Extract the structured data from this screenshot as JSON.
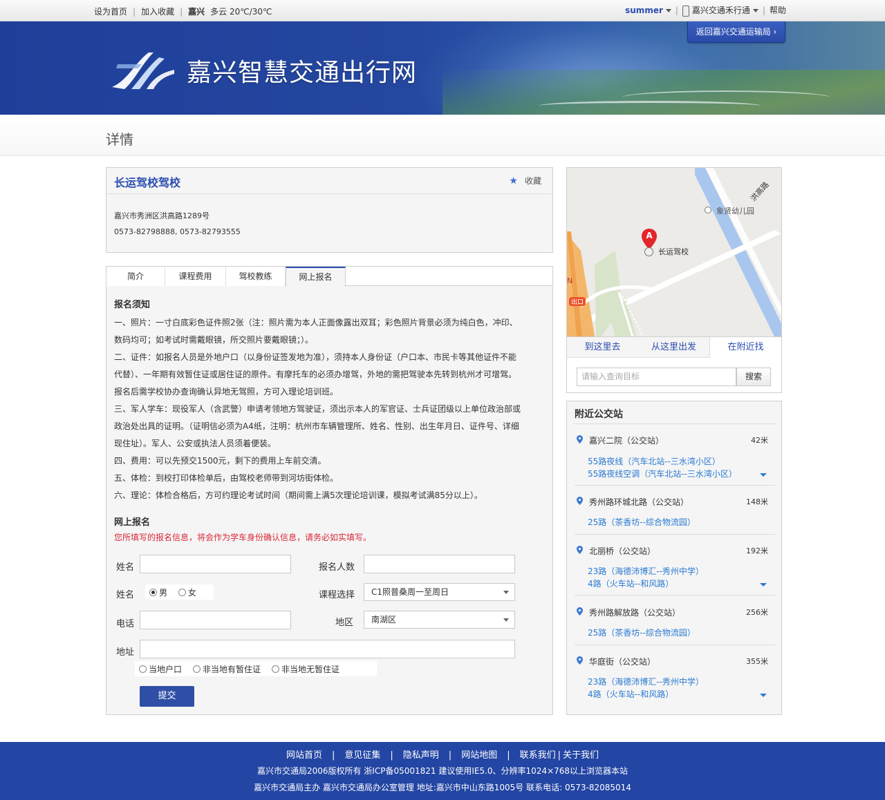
{
  "topbar": {
    "set_home": "设为首页",
    "add_fav": "加入收藏",
    "city": "嘉兴",
    "weather": "多云 20℃/30℃",
    "user": "summer",
    "app": "嘉兴交通禾行通",
    "help": "帮助"
  },
  "banner": {
    "site_title": "嘉兴智慧交通出行网",
    "back_label": "返回嘉兴交通运输局 ›"
  },
  "page": {
    "title": "详情"
  },
  "school": {
    "name": "长运驾校驾校",
    "fav_label": "收藏",
    "address": "嘉兴市秀洲区洪高路1289号",
    "phone": "0573-82798888, 0573-82793555"
  },
  "tabs": [
    {
      "label": "简介"
    },
    {
      "label": "课程费用"
    },
    {
      "label": "驾校教练"
    },
    {
      "label": "网上报名"
    }
  ],
  "notice": {
    "title": "报名须知",
    "lines": [
      "一、照片：一寸白底彩色证件照2张（注：照片需为本人正面像露出双耳；彩色照片背景必须为纯白色，冲印、",
      "数码均可；如考试时需戴眼镜，所交照片要戴眼镜；）。",
      "二、证件：如报名人员是外地户口（以身份证签发地为准），须持本人身份证（户口本、市民卡等其他证件不能",
      "代替）、一年期有效暂住证或居住证的原件。有摩托车的必须办增驾，外地的需把驾驶本先转到杭州才可增驾。",
      "报名后需学校协办查询确认异地无驾照，方可入理论培训班。",
      "三、军人学车：现役军人（含武警）申请考领地方驾驶证，须出示本人的军官证、士兵证团级以上单位政治部或",
      "政治处出具的证明。（证明信必须为A4纸，注明：杭州市车辆管理所、姓名、性别、出生年月日、证件号、详细",
      "现住址）。军人、公安或执法人员须着便装。",
      "四、费用：可以先预交1500元，剩下的费用上车前交清。",
      "五、体检：到校打印体检单后，由驾校老师带到河坊街体检。",
      "六、理论：体检合格后，方可约理论考试时间（期间需上满5次理论培训课，模拟考试满85分以上）。"
    ]
  },
  "form": {
    "title": "网上报名",
    "warning": "您所填写的报名信息，将会作为学车身份确认信息，请务必如实填写。",
    "name_label": "姓名",
    "count_label": "报名人数",
    "gender_label": "姓名",
    "male": "男",
    "female": "女",
    "course_label": "课程选择",
    "course_value": "C1照普桑周一至周日",
    "phone_label": "电话",
    "area_label": "地区",
    "area_value": "南湖区",
    "address_label": "地址",
    "residence_options": [
      "当地户口",
      "非当地有暂住证",
      "非当地无暂住证"
    ],
    "submit": "提交"
  },
  "map": {
    "road_label": "洪高路",
    "poi_kindergarten": "象贤幼儿园",
    "poi_school": "长运驾校",
    "marker": "A",
    "exit_label": "出口",
    "tabs": [
      "到这里去",
      "从这里出发",
      "在附近找"
    ],
    "search_placeholder": "请输入查询目标",
    "search_button": "搜索"
  },
  "bus": {
    "title": "附近公交站",
    "stations": [
      {
        "name": "嘉兴二院（公交站）",
        "distance": "42米",
        "routes": [
          "55路夜线（汽车北站--三水湾小区）",
          "55路夜线空调（汽车北站--三水湾小区）"
        ],
        "more": true
      },
      {
        "name": "秀州路环城北路（公交站）",
        "distance": "148米",
        "routes": [
          "25路（茶香坊--综合物流园）"
        ],
        "more": false
      },
      {
        "name": "北丽桥（公交站）",
        "distance": "192米",
        "routes": [
          "23路（海德沛博汇--秀州中学）",
          "4路（火车站--和风路）"
        ],
        "more": true
      },
      {
        "name": "秀州路解放路（公交站）",
        "distance": "256米",
        "routes": [
          "25路（茶香坊--综合物流园）"
        ],
        "more": false
      },
      {
        "name": "华庭街（公交站）",
        "distance": "355米",
        "routes": [
          "23路（海德沛博汇--秀州中学）",
          "4路（火车站--和风路）"
        ],
        "more": true
      }
    ]
  },
  "footer": {
    "links": [
      "网站首页",
      "意见征集",
      "隐私声明",
      "网站地图",
      "联系我们",
      "关于我们"
    ],
    "copyright": "嘉兴市交通局2006版权所有 浙ICP备05001821 建议使用IE5.0、分辨率1024×768以上浏览器本站",
    "host": "嘉兴市交通局主办 嘉兴市交通局办公室管理   地址:嘉兴市中山东路1005号 联系电话: 0573-82085014"
  },
  "colors": {
    "brand_blue": "#2345a3",
    "link_blue": "#2a4db0",
    "route_blue": "#2a7ad2",
    "warning_red": "#d9283a"
  }
}
